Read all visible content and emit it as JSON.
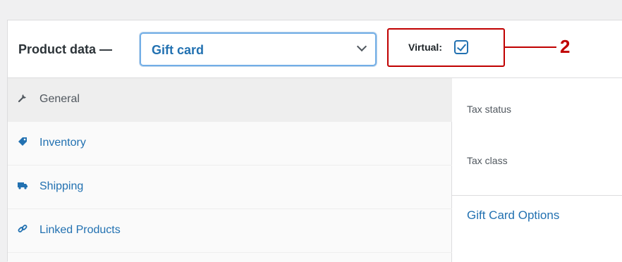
{
  "panel": {
    "title": "Product data —",
    "product_type_select": {
      "value": "Gift card"
    },
    "virtual": {
      "label": "Virtual:",
      "checked": true
    },
    "annotation": {
      "number": "2",
      "color": "#c00000"
    }
  },
  "tabs": [
    {
      "label": "General",
      "icon": "wrench-icon",
      "active": true
    },
    {
      "label": "Inventory",
      "icon": "tag-icon",
      "active": false
    },
    {
      "label": "Shipping",
      "icon": "truck-icon",
      "active": false
    },
    {
      "label": "Linked Products",
      "icon": "link-icon",
      "active": false
    }
  ],
  "fields": {
    "tax_status_label": "Tax status",
    "tax_class_label": "Tax class",
    "gift_card_options_title": "Gift Card Options"
  },
  "colors": {
    "accent": "#2271b1",
    "callout": "#c00000",
    "focus_ring": "#72aee6"
  }
}
